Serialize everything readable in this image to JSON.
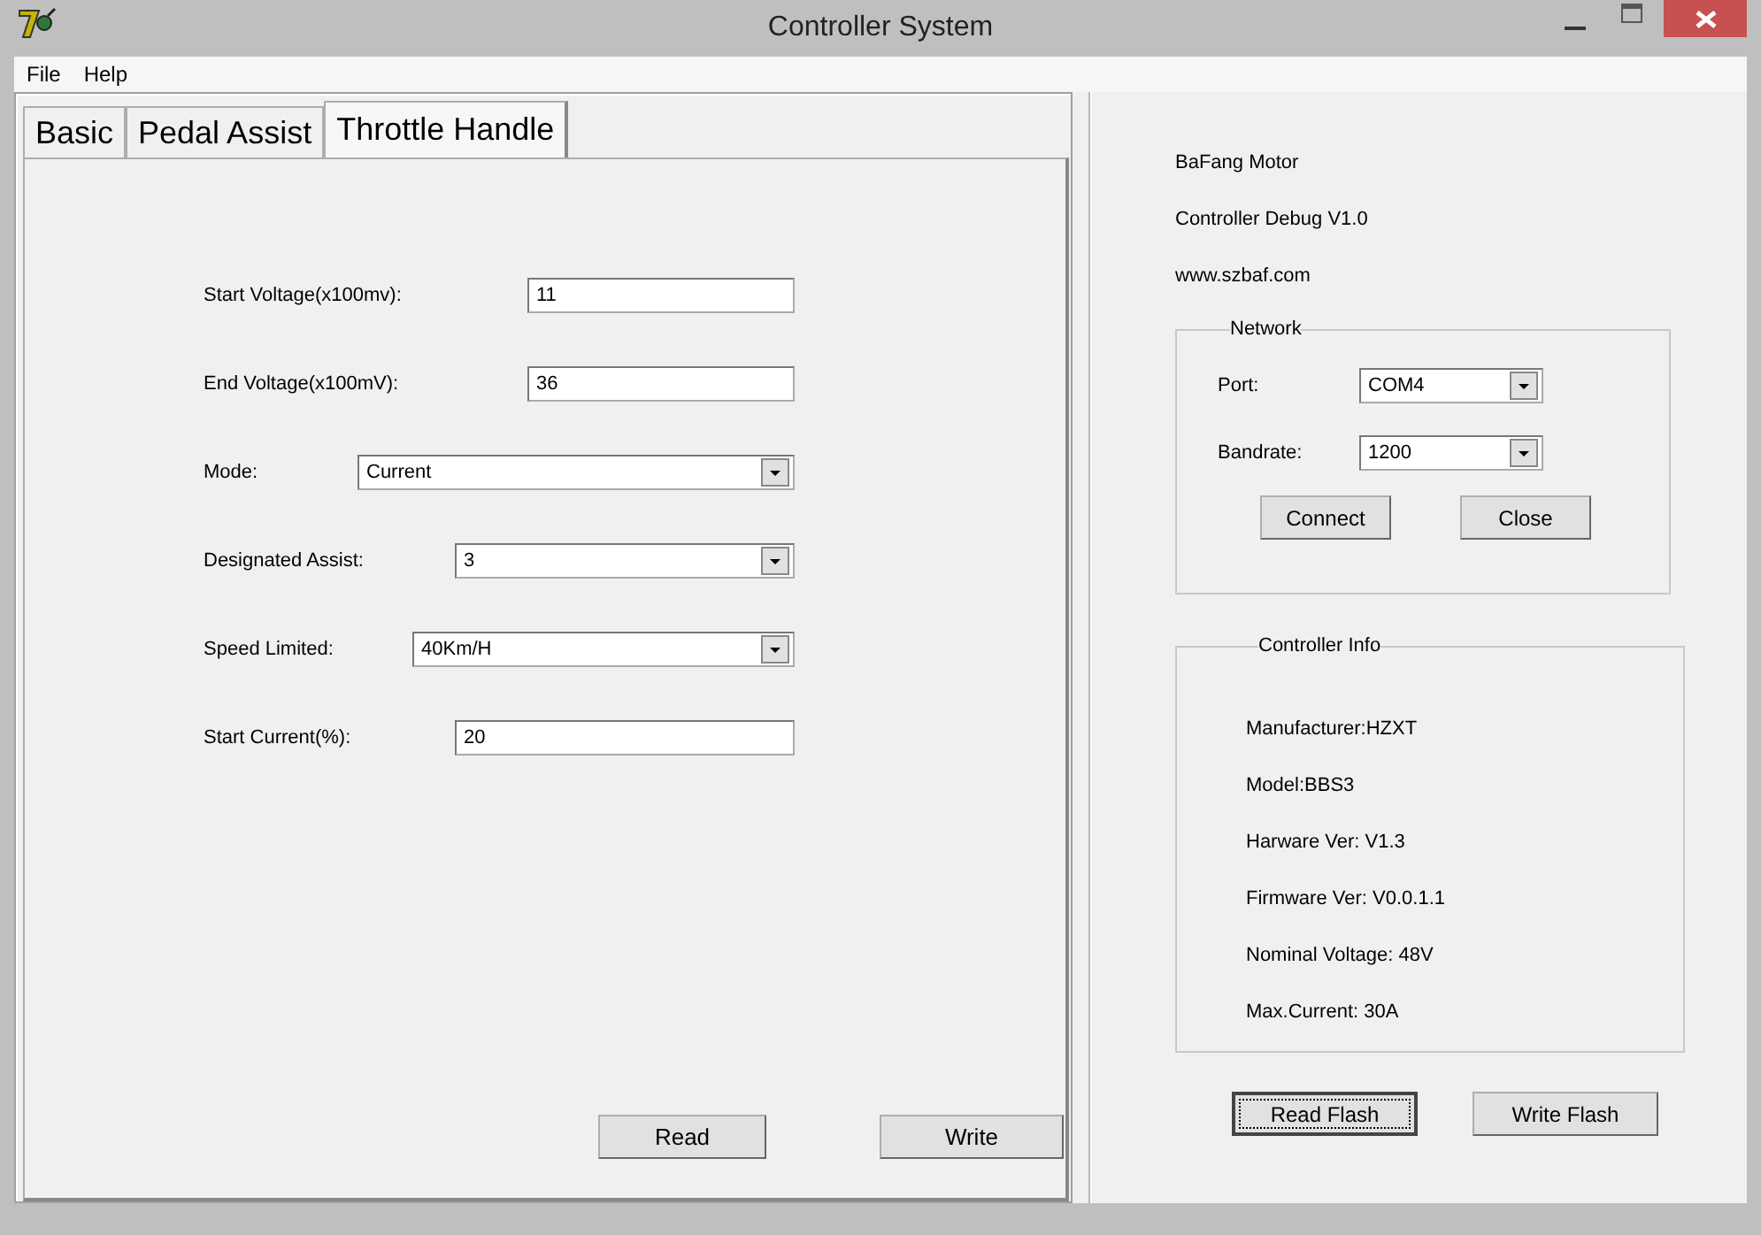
{
  "window": {
    "title": "Controller System"
  },
  "menu": [
    "File",
    "Help"
  ],
  "tabs": [
    {
      "label": "Basic",
      "selected": false
    },
    {
      "label": "Pedal Assist",
      "selected": false
    },
    {
      "label": "Throttle Handle",
      "selected": true
    }
  ],
  "form": [
    {
      "label": "Start Voltage(x100mv):",
      "kind": "text",
      "value": "11"
    },
    {
      "label": "End Voltage(x100mV):",
      "kind": "text",
      "value": "36"
    },
    {
      "label": "Mode:",
      "kind": "dropdown",
      "value": "Current"
    },
    {
      "label": "Designated Assist:",
      "kind": "dropdown",
      "value": "3"
    },
    {
      "label": "Speed Limited:",
      "kind": "dropdown",
      "value": "40Km/H"
    },
    {
      "label": "Start Current(%):",
      "kind": "text",
      "value": "20"
    }
  ],
  "left_buttons": [
    "Read",
    "Write"
  ],
  "about": [
    "BaFang Motor",
    "Controller Debug V1.0",
    "www.szbaf.com"
  ],
  "network": {
    "title": "Network",
    "fields": [
      {
        "label": "Port:",
        "value": "COM4"
      },
      {
        "label": "Bandrate:",
        "value": "1200"
      }
    ],
    "buttons": [
      "Connect",
      "Close"
    ]
  },
  "controller_info": {
    "title": "Controller Info",
    "lines": [
      "Manufacturer:HZXT",
      "Model:BBS3",
      "Harware Ver: V1.3",
      "Firmware Ver: V0.0.1.1",
      "Nominal Voltage: 48V",
      "Max.Current: 30A"
    ]
  },
  "flash_buttons": [
    {
      "label": "Read Flash",
      "focused": true
    },
    {
      "label": "Write Flash",
      "focused": false
    }
  ]
}
